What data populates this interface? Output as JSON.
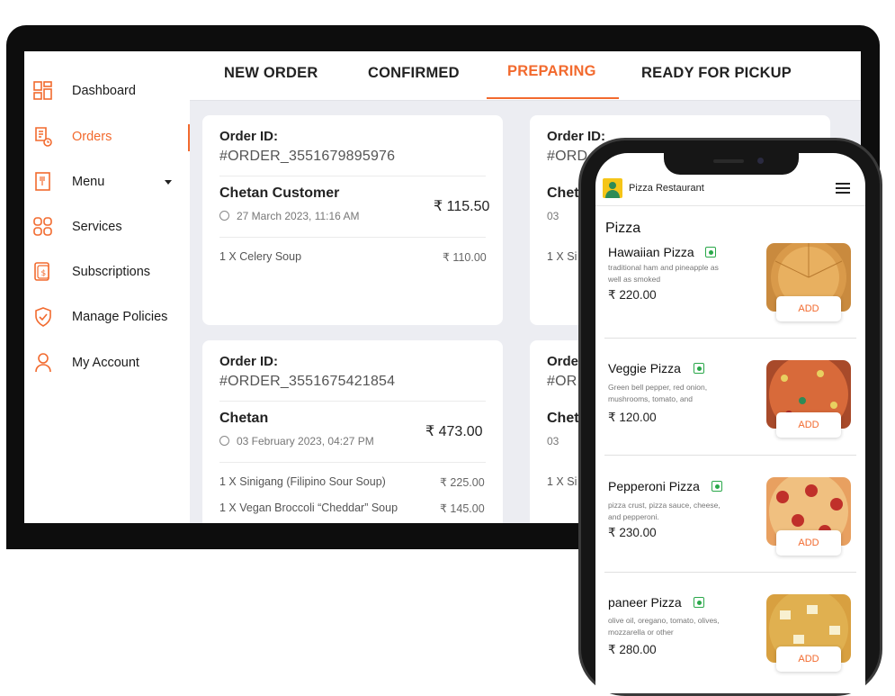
{
  "sidebar": {
    "items": [
      {
        "label": "Dashboard",
        "icon": "dashboard-icon"
      },
      {
        "label": "Orders",
        "icon": "orders-icon"
      },
      {
        "label": "Menu",
        "icon": "menu-icon"
      },
      {
        "label": "Services",
        "icon": "services-icon"
      },
      {
        "label": "Subscriptions",
        "icon": "subscriptions-icon"
      },
      {
        "label": "Manage Policies",
        "icon": "shield-icon"
      },
      {
        "label": "My Account",
        "icon": "user-icon"
      }
    ],
    "active": "Orders"
  },
  "tabs": {
    "items": [
      "NEW ORDER",
      "CONFIRMED",
      "PREPARING",
      "READY FOR PICKUP"
    ],
    "active": "PREPARING"
  },
  "orders": [
    {
      "label": "Order ID:",
      "id": "#ORDER_3551679895976",
      "customer": "Chetan Customer",
      "date": "27 March 2023, 11:16 AM",
      "total": "₹ 115.50",
      "items": [
        {
          "qty_name": "1 X  Celery Soup",
          "price": "₹ 110.00"
        }
      ]
    },
    {
      "label": "Order ID:",
      "id": "#ORDER_3551675421854",
      "customer": "Chetan",
      "date": "03 February 2023, 04:27 PM",
      "total": "₹ 473.00",
      "items": [
        {
          "qty_name": "1 X  Sinigang (Filipino Sour Soup)",
          "price": "₹ 225.00"
        },
        {
          "qty_name": "1 X  Vegan Broccoli “Cheddar” Soup",
          "price": "₹ 145.00"
        }
      ]
    }
  ],
  "orders_partial": [
    {
      "label": "Order ID:",
      "id": "#ORD",
      "customer": "Chet",
      "date": "03",
      "item": "1 X  Si"
    },
    {
      "label": "Orde",
      "id": "#OR",
      "customer": "Chet",
      "date": "03",
      "item": "1 X  Si"
    }
  ],
  "phone": {
    "restaurant": "Pizza Restaurant",
    "category": "Pizza",
    "add_label": "ADD",
    "items": [
      {
        "name": "Hawaiian Pizza",
        "desc": "traditional ham and pineapple as well as smoked",
        "price": "₹ 220.00"
      },
      {
        "name": "Veggie Pizza",
        "desc": "Green bell pepper, red onion, mushrooms, tomato, and",
        "price": "₹ 120.00"
      },
      {
        "name": "Pepperoni Pizza",
        "desc": "pizza crust, pizza sauce, cheese, and pepperoni.",
        "price": "₹ 230.00"
      },
      {
        "name": "paneer Pizza",
        "desc": "olive oil, oregano, tomato, olives, mozzarella or other",
        "price": "₹ 280.00"
      }
    ]
  },
  "colors": {
    "accent": "#f26a2e",
    "veg": "#2aa84a"
  }
}
